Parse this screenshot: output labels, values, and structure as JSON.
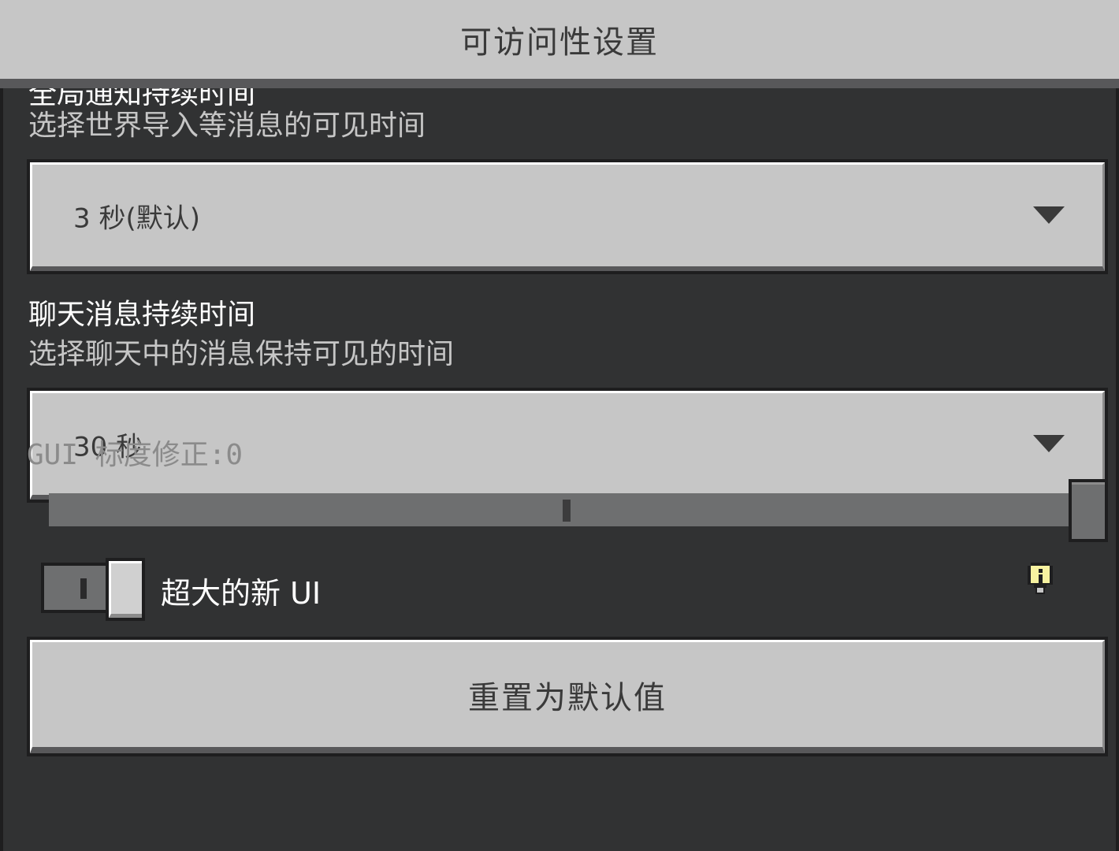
{
  "header": {
    "title": "可访问性设置"
  },
  "settings": {
    "notification": {
      "label_cut": "全局通知持续时间",
      "description": "选择世界导入等消息的可见时间",
      "value": "3 秒(默认)"
    },
    "chat": {
      "label": "聊天消息持续时间",
      "description": "选择聊天中的消息保持可见的时间",
      "value": "30 秒"
    },
    "gui_scale": {
      "label": "GUI 标度修正:0",
      "value": 0
    },
    "large_ui": {
      "label": "超大的新 UI",
      "enabled": false
    },
    "reset_label": "重置为默认值"
  },
  "icons": {
    "dropdown_caret": "chevron-down-icon",
    "hint": "lightbulb-icon"
  },
  "colors": {
    "background": "#313233",
    "control_face": "#c6c6c6",
    "header": "#c6c6c6",
    "slider_track": "#6e6f70",
    "hint_icon": "#f7f2a0"
  }
}
